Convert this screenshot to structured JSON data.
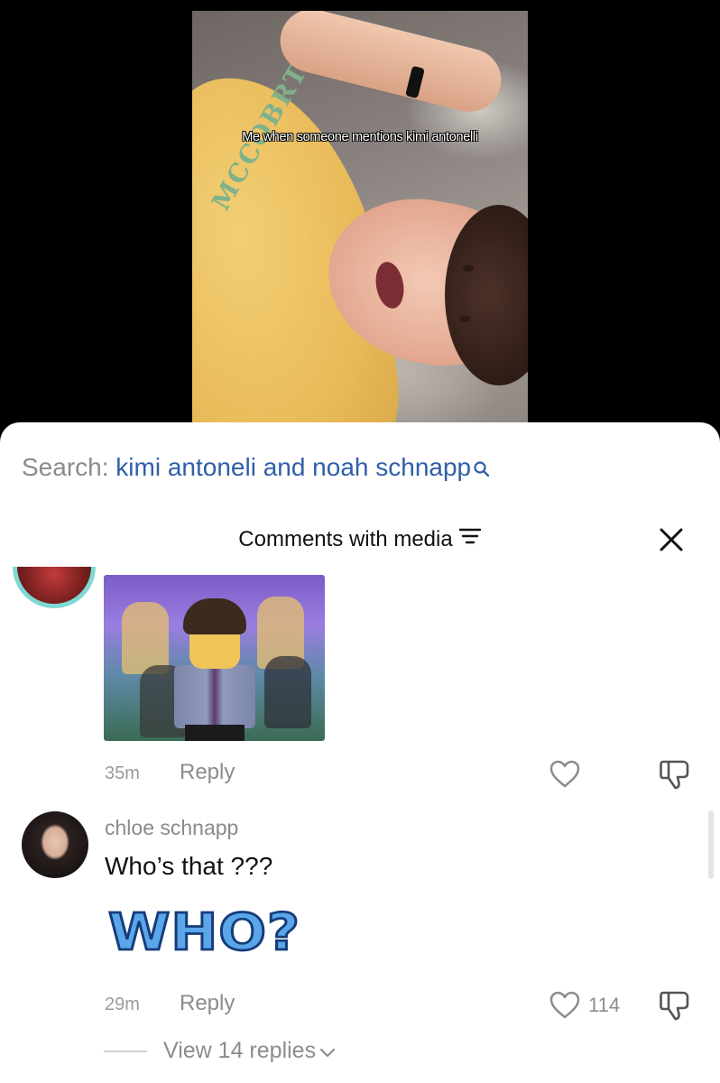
{
  "video": {
    "caption": "Me when someone mentions kimi antonelli",
    "shirt_print": "MCCOBRTE W"
  },
  "search": {
    "label": "Search:",
    "query": "kimi antoneli and noah schnapp",
    "icon": "search-icon"
  },
  "comments_header": {
    "title": "Comments with media",
    "sort_icon": "sort-icon",
    "close_icon": "close-icon"
  },
  "comments": [
    {
      "media": "lego-minifigure-image",
      "time": "35m",
      "reply_label": "Reply",
      "like_icon": "heart-icon",
      "dislike_icon": "thumbs-down-icon"
    },
    {
      "username": "chloe schnapp",
      "text": "Who’s that ???",
      "sticker_text": "WHO?",
      "time": "29m",
      "reply_label": "Reply",
      "likes": "114",
      "view_replies": "View 14 replies"
    }
  ],
  "colors": {
    "link_blue": "#2f5ea8",
    "avatar_ring": "#7fd9d2",
    "muted_text": "#8c8c8c"
  }
}
